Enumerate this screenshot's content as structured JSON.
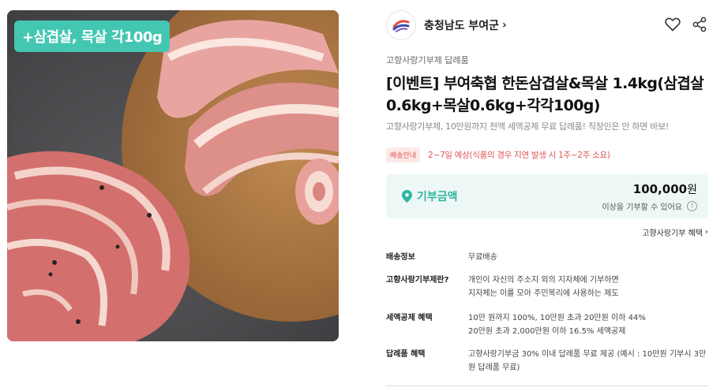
{
  "product": {
    "promo_badge": "+삼겹살, 목살 각100g",
    "image_icon": "pork-meat-photo"
  },
  "seller": {
    "name": "충청남도 부여군",
    "chevron": "›",
    "logo_icon": "buyeo-county-logo-icon"
  },
  "actions": {
    "like_icon": "heart-icon",
    "share_icon": "share-icon"
  },
  "category": "고향사랑기부제 답례품",
  "title": "[이벤트] 부여축협 한돈삼겹살&목살 1.4kg(삼겹살 0.6kg+목살0.6kg+각각100g)",
  "subtitle": "고향사랑기부제, 10만원까지 전액 세액공제 무료 답례품! 직장인은 안 하면 바보!",
  "delivery": {
    "badge": "배송안내",
    "text": "2~7일 예상(식품의 경우 지연 발생 시 1주~2주 소요)"
  },
  "donation": {
    "label": "기부금액",
    "amount": "100,000",
    "unit": "원",
    "note": "이상을 기부할 수 있어요",
    "help": "?",
    "accent": "#2fb5a0"
  },
  "benefit_link": "고향사랑기부 혜택",
  "info": [
    {
      "key": "배송정보",
      "lines": [
        "무료배송"
      ]
    },
    {
      "key": "고향사랑기부제란?",
      "lines": [
        "개인이 자신의 주소지 외의 지자체에 기부하면",
        "지자체는 이를 모아 주민복리에 사용하는 제도"
      ]
    },
    {
      "key": "세액공제 혜택",
      "lines": [
        "10만 원까지 100%, 10만원 초과 20만원 이하 44%",
        "20만원 초과 2,000만원 이하 16.5% 세액공제"
      ]
    },
    {
      "key": "답례품 혜택",
      "lines": [
        "고향사랑기부금 30% 이내 답례품 무료 제공 (예시 : 10만원 기부시 3만",
        "원 답례품 무료)"
      ]
    }
  ],
  "colors": {
    "badge_bg": "#43c7b2",
    "delivery_red": "#e05555",
    "donation_bg": "#edf8f6"
  }
}
